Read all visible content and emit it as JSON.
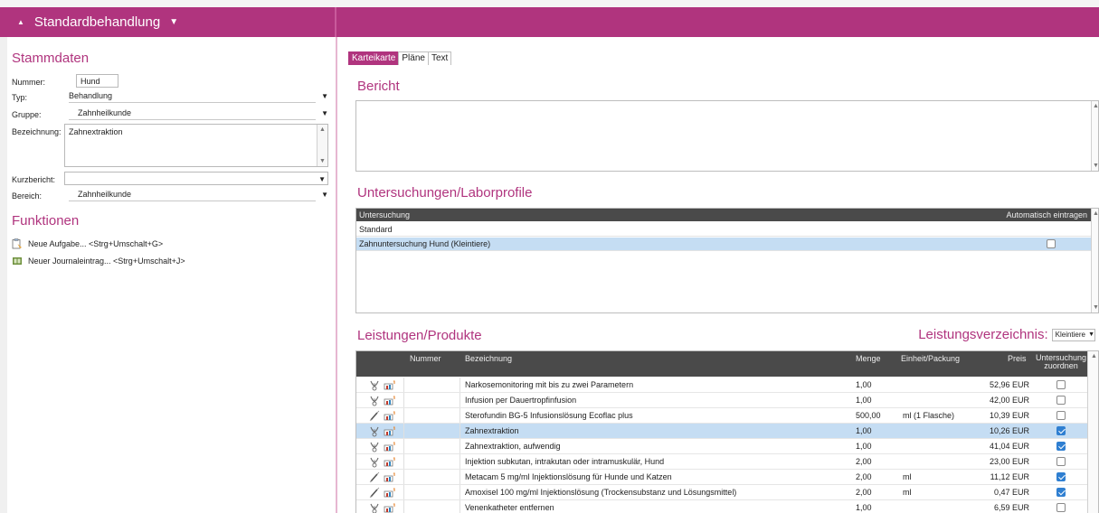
{
  "header": {
    "title": "Standardbehandlung"
  },
  "stammdaten": {
    "title": "Stammdaten",
    "nummer_label": "Nummer:",
    "nummer_value": "Hund",
    "typ_label": "Typ:",
    "typ_value": "Behandlung",
    "gruppe_label": "Gruppe:",
    "gruppe_value": "Zahnheilkunde",
    "bezeichnung_label": "Bezeichnung:",
    "bezeichnung_value": "Zahnextraktion",
    "kurzbericht_label": "Kurzbericht:",
    "kurzbericht_value": "",
    "bereich_label": "Bereich:",
    "bereich_value": "Zahnheilkunde"
  },
  "funktionen": {
    "title": "Funktionen",
    "items": [
      {
        "label": "Neue Aufgabe... <Strg+Umschalt+G>",
        "icon": "task-icon"
      },
      {
        "label": "Neuer Journaleintrag... <Strg+Umschalt+J>",
        "icon": "journal-icon"
      }
    ]
  },
  "tabs": [
    {
      "label": "Karteikarte",
      "active": true
    },
    {
      "label": "Pläne",
      "active": false
    },
    {
      "label": "Text",
      "active": false
    }
  ],
  "bericht": {
    "title": "Bericht",
    "text": ""
  },
  "untersuchungen": {
    "title": "Untersuchungen/Laborprofile",
    "col_untersuchung": "Untersuchung",
    "col_auto": "Automatisch eintragen",
    "rows": [
      {
        "name": "Standard",
        "checkbox": false,
        "selected": false
      },
      {
        "name": "Zahnuntersuchung Hund (Kleintiere)",
        "checkbox": true,
        "checked": false,
        "selected": true
      }
    ]
  },
  "leistungen": {
    "title": "Leistungen/Produkte",
    "verzeichnis_label": "Leistungsverzeichnis:",
    "verzeichnis_value": "Kleintiere",
    "columns": {
      "nummer": "Nummer",
      "bezeichnung": "Bezeichnung",
      "menge": "Menge",
      "einheit": "Einheit/Packung",
      "preis": "Preis",
      "untersuchung": "Untersuchung",
      "zuordnen": "zuordnen"
    },
    "rows": [
      {
        "icon": "service",
        "nummer": "",
        "bezeichnung": "Narkosemonitoring mit bis zu zwei Parametern",
        "menge": "1,00",
        "einheit": "",
        "preis": "52,96 EUR",
        "checked": false,
        "selected": false
      },
      {
        "icon": "service",
        "nummer": "",
        "bezeichnung": "Infusion per Dauertropfinfusion",
        "menge": "1,00",
        "einheit": "",
        "preis": "42,00 EUR",
        "checked": false,
        "selected": false
      },
      {
        "icon": "product",
        "nummer": "",
        "bezeichnung": "Sterofundin BG-5 Infusionslösung Ecoflac plus",
        "menge": "500,00",
        "einheit": "ml (1 Flasche)",
        "preis": "10,39 EUR",
        "checked": false,
        "selected": false
      },
      {
        "icon": "service",
        "nummer": "",
        "bezeichnung": "Zahnextraktion",
        "menge": "1,00",
        "einheit": "",
        "preis": "10,26 EUR",
        "checked": true,
        "selected": true
      },
      {
        "icon": "service",
        "nummer": "",
        "bezeichnung": "Zahnextraktion, aufwendig",
        "menge": "1,00",
        "einheit": "",
        "preis": "41,04 EUR",
        "checked": true,
        "selected": false
      },
      {
        "icon": "service",
        "nummer": "",
        "bezeichnung": "Injektion subkutan, intrakutan oder intramuskulär, Hund",
        "menge": "2,00",
        "einheit": "",
        "preis": "23,00 EUR",
        "checked": false,
        "selected": false
      },
      {
        "icon": "product",
        "nummer": "",
        "bezeichnung": "Metacam 5 mg/ml Injektionslösung für Hunde und Katzen",
        "menge": "2,00",
        "einheit": "ml",
        "preis": "11,12 EUR",
        "checked": true,
        "selected": false
      },
      {
        "icon": "product",
        "nummer": "",
        "bezeichnung": "Amoxisel 100 mg/ml Injektionslösung (Trockensubstanz und Lösungsmittel)",
        "menge": "2,00",
        "einheit": "ml",
        "preis": "0,47 EUR",
        "checked": true,
        "selected": false
      },
      {
        "icon": "service",
        "nummer": "",
        "bezeichnung": "Venenkatheter entfernen",
        "menge": "1,00",
        "einheit": "",
        "preis": "6,59 EUR",
        "checked": false,
        "selected": false
      }
    ]
  },
  "colors": {
    "accent": "#b0347e",
    "selected_row": "#c5ddf3",
    "table_header": "#4a4a4a",
    "checkbox_on": "#2f7fd1"
  }
}
